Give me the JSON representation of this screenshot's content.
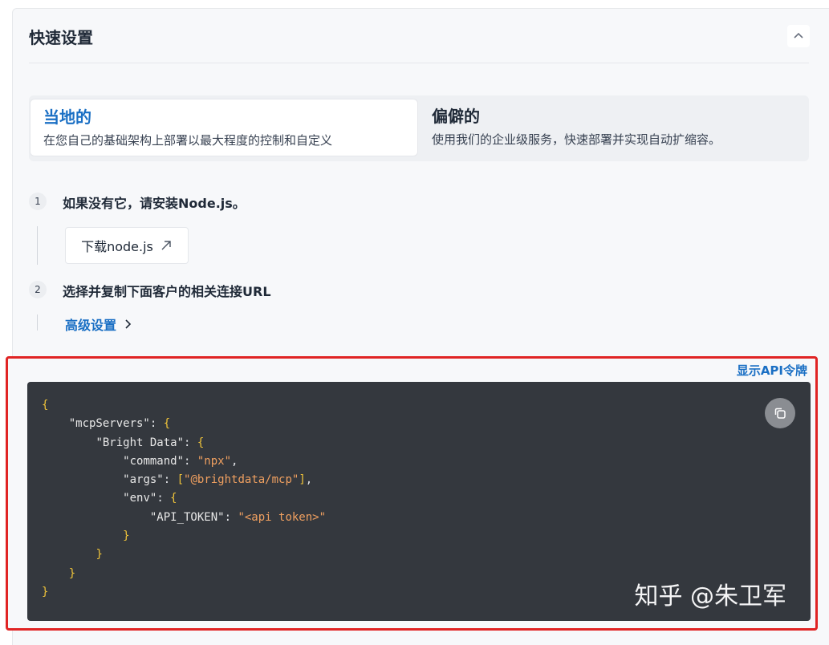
{
  "section": {
    "title": "快速设置"
  },
  "deploy_options": [
    {
      "title": "当地的",
      "description": "在您自己的基础架构上部署以最大程度的控制和自定义",
      "selected": true
    },
    {
      "title": "偏僻的",
      "description": "使用我们的企业级服务，快速部署并实现自动扩缩容。",
      "selected": false
    }
  ],
  "steps": [
    {
      "number": "1",
      "text": "如果没有它，请安装Node.js。",
      "action_label": "下载node.js"
    },
    {
      "number": "2",
      "text": "选择并复制下面客户的相关连接URL",
      "action_label": "高级设置"
    }
  ],
  "code_panel": {
    "show_token_label": "显示API令牌",
    "lines": [
      {
        "indent": "",
        "parts": [
          [
            "b",
            "{"
          ]
        ]
      },
      {
        "indent": "    ",
        "parts": [
          [
            "k",
            "\"mcpServers\""
          ],
          [
            "p",
            ": "
          ],
          [
            "b",
            "{"
          ]
        ]
      },
      {
        "indent": "        ",
        "parts": [
          [
            "k",
            "\"Bright Data\""
          ],
          [
            "p",
            ": "
          ],
          [
            "b",
            "{"
          ]
        ]
      },
      {
        "indent": "            ",
        "parts": [
          [
            "k",
            "\"command\""
          ],
          [
            "p",
            ": "
          ],
          [
            "s",
            "\"npx\""
          ],
          [
            "p",
            ","
          ]
        ]
      },
      {
        "indent": "            ",
        "parts": [
          [
            "k",
            "\"args\""
          ],
          [
            "p",
            ": "
          ],
          [
            "b",
            "["
          ],
          [
            "s",
            "\"@brightdata/mcp\""
          ],
          [
            "b",
            "]"
          ],
          [
            "p",
            ","
          ]
        ]
      },
      {
        "indent": "            ",
        "parts": [
          [
            "k",
            "\"env\""
          ],
          [
            "p",
            ": "
          ],
          [
            "b",
            "{"
          ]
        ]
      },
      {
        "indent": "                ",
        "parts": [
          [
            "k",
            "\"API_TOKEN\""
          ],
          [
            "p",
            ": "
          ],
          [
            "s",
            "\"<api token>\""
          ]
        ]
      },
      {
        "indent": "            ",
        "parts": [
          [
            "b",
            "}"
          ]
        ]
      },
      {
        "indent": "        ",
        "parts": [
          [
            "b",
            "}"
          ]
        ]
      },
      {
        "indent": "    ",
        "parts": [
          [
            "b",
            "}"
          ]
        ]
      },
      {
        "indent": "",
        "parts": [
          [
            "b",
            "}"
          ]
        ]
      }
    ]
  },
  "watermark": "知乎 @朱卫军",
  "icons": {
    "collapse": "chevron-up-icon",
    "external_link": "arrow-up-right-icon",
    "advanced": "chevron-right-icon",
    "copy": "copy-icon"
  },
  "colors": {
    "accent": "#1a6fc4",
    "highlight_border": "#e02424",
    "code_bg": "#34383e",
    "code_bracket": "#f0c43a",
    "code_string": "#f0a060"
  }
}
